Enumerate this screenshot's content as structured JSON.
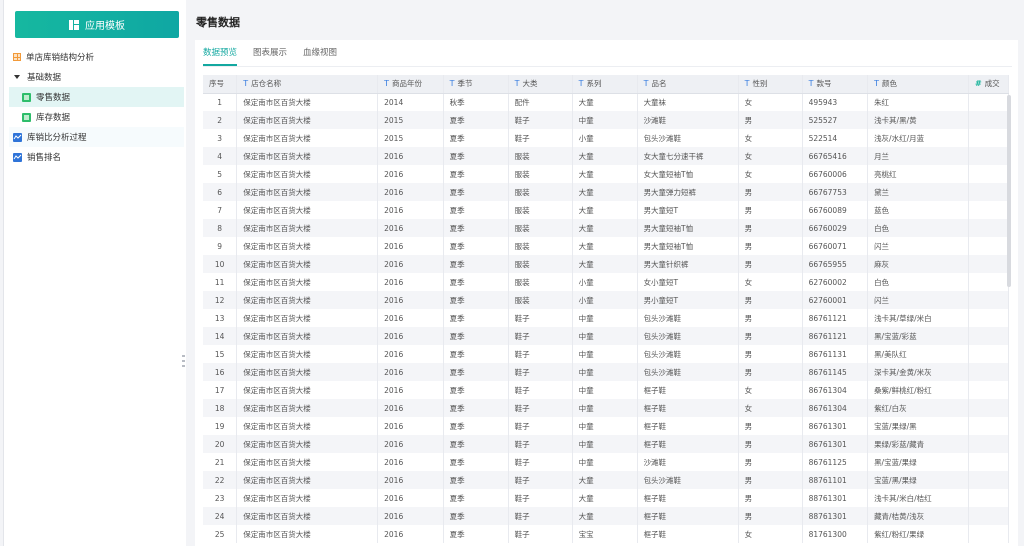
{
  "sidebar": {
    "app_button_label": "应用模板",
    "items": [
      {
        "label": "单店库销结构分析",
        "icon": "dashboard-grid-icon",
        "level": 0
      },
      {
        "label": "基础数据",
        "icon": "caret-down-icon",
        "level": 0
      },
      {
        "label": "零售数据",
        "icon": "table-icon",
        "level": 1,
        "active": true
      },
      {
        "label": "库存数据",
        "icon": "table-icon",
        "level": 1
      },
      {
        "label": "库销比分析过程",
        "icon": "line-chart-icon",
        "level": 0
      },
      {
        "label": "销售排名",
        "icon": "line-chart-icon",
        "level": 0
      }
    ]
  },
  "main": {
    "title": "零售数据",
    "tabs": [
      {
        "label": "数据预览",
        "active": true
      },
      {
        "label": "图表展示",
        "active": false
      },
      {
        "label": "血缘视图",
        "active": false
      }
    ],
    "table": {
      "columns": [
        {
          "label": "序号",
          "type": ""
        },
        {
          "label": "店仓名称",
          "type": "T"
        },
        {
          "label": "商品年份",
          "type": "T"
        },
        {
          "label": "季节",
          "type": "T"
        },
        {
          "label": "大类",
          "type": "T"
        },
        {
          "label": "系列",
          "type": "T"
        },
        {
          "label": "品名",
          "type": "T"
        },
        {
          "label": "性别",
          "type": "T"
        },
        {
          "label": "款号",
          "type": "T"
        },
        {
          "label": "颜色",
          "type": "T"
        },
        {
          "label": "成交",
          "type": "#"
        }
      ],
      "rows": [
        [
          "1",
          "保定南市区百货大楼",
          "2014",
          "秋季",
          "配件",
          "大童",
          "大童袜",
          "女",
          "495943",
          "朱红",
          ""
        ],
        [
          "2",
          "保定南市区百货大楼",
          "2015",
          "夏季",
          "鞋子",
          "中童",
          "沙滩鞋",
          "男",
          "525527",
          "浅卡其/黑/黄",
          ""
        ],
        [
          "3",
          "保定南市区百货大楼",
          "2015",
          "夏季",
          "鞋子",
          "小童",
          "包头沙滩鞋",
          "女",
          "522514",
          "浅灰/水红/月蓝",
          ""
        ],
        [
          "4",
          "保定南市区百货大楼",
          "2016",
          "夏季",
          "服装",
          "大童",
          "女大童七分速干裤",
          "女",
          "66765416",
          "月兰",
          ""
        ],
        [
          "5",
          "保定南市区百货大楼",
          "2016",
          "夏季",
          "服装",
          "大童",
          "女大童短袖T恤",
          "女",
          "66760006",
          "亮桃红",
          ""
        ],
        [
          "6",
          "保定南市区百货大楼",
          "2016",
          "夏季",
          "服装",
          "大童",
          "男大童弹力短裤",
          "男",
          "66767753",
          "黛兰",
          ""
        ],
        [
          "7",
          "保定南市区百货大楼",
          "2016",
          "夏季",
          "服装",
          "大童",
          "男大童短T",
          "男",
          "66760089",
          "蓝色",
          ""
        ],
        [
          "8",
          "保定南市区百货大楼",
          "2016",
          "夏季",
          "服装",
          "大童",
          "男大童短袖T恤",
          "男",
          "66760029",
          "白色",
          ""
        ],
        [
          "9",
          "保定南市区百货大楼",
          "2016",
          "夏季",
          "服装",
          "大童",
          "男大童短袖T恤",
          "男",
          "66760071",
          "闪兰",
          ""
        ],
        [
          "10",
          "保定南市区百货大楼",
          "2016",
          "夏季",
          "服装",
          "大童",
          "男大童针织裤",
          "男",
          "66765955",
          "麻灰",
          ""
        ],
        [
          "11",
          "保定南市区百货大楼",
          "2016",
          "夏季",
          "服装",
          "小童",
          "女小童短T",
          "女",
          "62760002",
          "白色",
          ""
        ],
        [
          "12",
          "保定南市区百货大楼",
          "2016",
          "夏季",
          "服装",
          "小童",
          "男小童短T",
          "男",
          "62760001",
          "闪兰",
          ""
        ],
        [
          "13",
          "保定南市区百货大楼",
          "2016",
          "夏季",
          "鞋子",
          "中童",
          "包头沙滩鞋",
          "男",
          "86761121",
          "浅卡其/草绿/米白",
          ""
        ],
        [
          "14",
          "保定南市区百货大楼",
          "2016",
          "夏季",
          "鞋子",
          "中童",
          "包头沙滩鞋",
          "男",
          "86761121",
          "黑/宝蓝/彩蓝",
          ""
        ],
        [
          "15",
          "保定南市区百货大楼",
          "2016",
          "夏季",
          "鞋子",
          "中童",
          "包头沙滩鞋",
          "男",
          "86761131",
          "黑/美队红",
          ""
        ],
        [
          "16",
          "保定南市区百货大楼",
          "2016",
          "夏季",
          "鞋子",
          "中童",
          "包头沙滩鞋",
          "男",
          "86761145",
          "深卡其/金黄/米灰",
          ""
        ],
        [
          "17",
          "保定南市区百货大楼",
          "2016",
          "夏季",
          "鞋子",
          "中童",
          "框子鞋",
          "女",
          "86761304",
          "桑紫/鲜桃红/粉红",
          ""
        ],
        [
          "18",
          "保定南市区百货大楼",
          "2016",
          "夏季",
          "鞋子",
          "中童",
          "框子鞋",
          "女",
          "86761304",
          "紫红/白灰",
          ""
        ],
        [
          "19",
          "保定南市区百货大楼",
          "2016",
          "夏季",
          "鞋子",
          "中童",
          "框子鞋",
          "男",
          "86761301",
          "宝蓝/果绿/黑",
          ""
        ],
        [
          "20",
          "保定南市区百货大楼",
          "2016",
          "夏季",
          "鞋子",
          "中童",
          "框子鞋",
          "男",
          "86761301",
          "果绿/彩蓝/藏青",
          ""
        ],
        [
          "21",
          "保定南市区百货大楼",
          "2016",
          "夏季",
          "鞋子",
          "中童",
          "沙滩鞋",
          "男",
          "86761125",
          "黑/宝蓝/果绿",
          ""
        ],
        [
          "22",
          "保定南市区百货大楼",
          "2016",
          "夏季",
          "鞋子",
          "大童",
          "包头沙滩鞋",
          "男",
          "88761101",
          "宝蓝/黑/果绿",
          ""
        ],
        [
          "23",
          "保定南市区百货大楼",
          "2016",
          "夏季",
          "鞋子",
          "大童",
          "框子鞋",
          "男",
          "88761301",
          "浅卡其/米白/桔红",
          ""
        ],
        [
          "24",
          "保定南市区百货大楼",
          "2016",
          "夏季",
          "鞋子",
          "大童",
          "框子鞋",
          "男",
          "88761301",
          "藏青/桔黄/浅灰",
          ""
        ],
        [
          "25",
          "保定南市区百货大楼",
          "2016",
          "夏季",
          "鞋子",
          "宝宝",
          "框子鞋",
          "女",
          "81761300",
          "紫红/粉红/果绿",
          ""
        ]
      ]
    }
  },
  "colors": {
    "accent": "#13a8a0",
    "type_text_icon": "#3b7fe0",
    "type_number_icon": "#17b39a"
  }
}
